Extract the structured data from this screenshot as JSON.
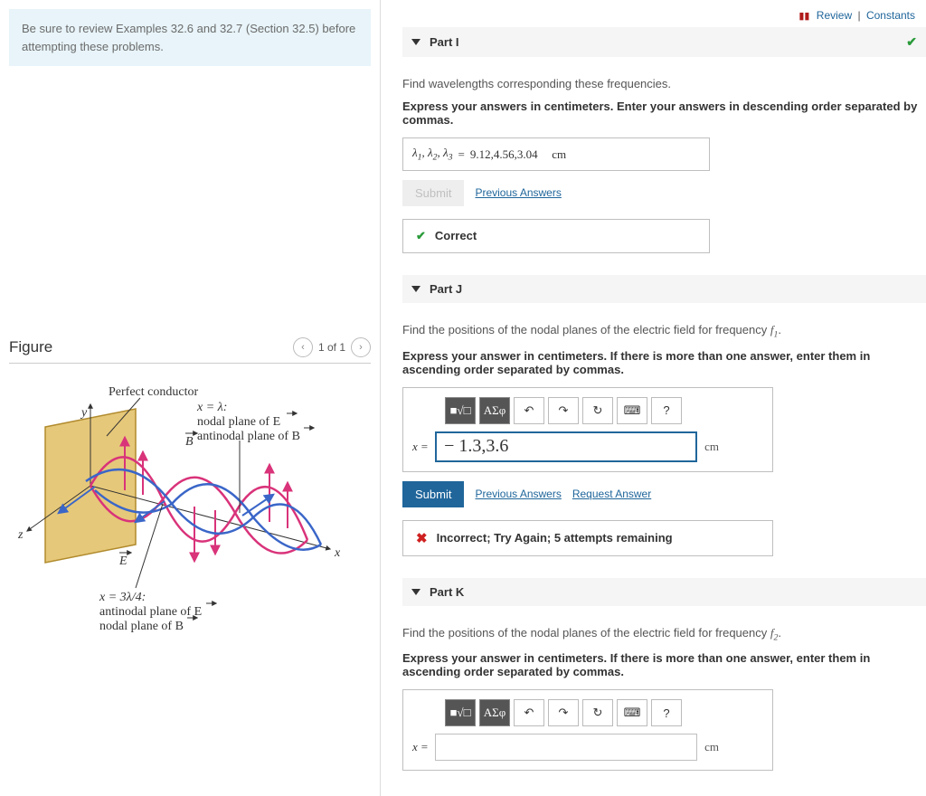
{
  "info_box": "Be sure to review Examples 32.6 and 32.7 (Section 32.5) before attempting these problems.",
  "top_links": {
    "review": "Review",
    "constants": "Constants"
  },
  "figure": {
    "title": "Figure",
    "nav_label": "1 of 1"
  },
  "figure_labels": {
    "perfect_conductor": "Perfect conductor",
    "y": "y",
    "z": "z",
    "x": "x",
    "E": "E",
    "B": "B",
    "x_lambda": "x = λ:",
    "nodal_E": "nodal plane of E",
    "antinodal_B": "antinodal plane of B",
    "x_3lambda4": "x = 3λ/4:",
    "antinodal_E": "antinodal plane of E",
    "nodal_B": "nodal plane of B"
  },
  "partI": {
    "title": "Part I",
    "prompt": "Find wavelengths corresponding these frequencies.",
    "instr": "Express your answers in centimeters. Enter your answers in descending order separated by commas.",
    "lambda_label_l1": "λ",
    "lambda_label_l2": "λ",
    "lambda_label_l3": "λ",
    "s1": "1",
    "s2": "2",
    "s3": "3",
    "eq": "=",
    "value": "9.12,4.56,3.04",
    "unit": "cm",
    "submit": "Submit",
    "prev": "Previous Answers",
    "status": "Correct"
  },
  "partJ": {
    "title": "Part J",
    "prompt_pre": "Find the positions of the nodal planes of the electric field for frequency ",
    "freq_sym": "f",
    "freq_sub": "1",
    "period": ".",
    "instr": "Express your answer in centimeters. If there is more than one answer, enter them in ascending order separated by commas.",
    "x_label": "x",
    "eq": "=",
    "value": "− 1.3,3.6",
    "unit": "cm",
    "submit": "Submit",
    "prev": "Previous Answers",
    "request": "Request Answer",
    "status": "Incorrect; Try Again; 5 attempts remaining",
    "tb_sym1": "■√□",
    "tb_sym2": "ΑΣφ",
    "tb_undo": "↶",
    "tb_redo": "↷",
    "tb_reset": "↻",
    "tb_kbd": "⌨",
    "tb_help": "?"
  },
  "partK": {
    "title": "Part K",
    "prompt_pre": "Find the positions of the nodal planes of the electric field for frequency ",
    "freq_sym": "f",
    "freq_sub": "2",
    "period": ".",
    "instr": "Express your answer in centimeters. If there is more than one answer, enter them in ascending order separated by commas.",
    "x_label": "x",
    "eq": "=",
    "value": "",
    "unit": "cm",
    "tb_sym1": "■√□",
    "tb_sym2": "ΑΣφ",
    "tb_undo": "↶",
    "tb_redo": "↷",
    "tb_reset": "↻",
    "tb_kbd": "⌨",
    "tb_help": "?"
  }
}
